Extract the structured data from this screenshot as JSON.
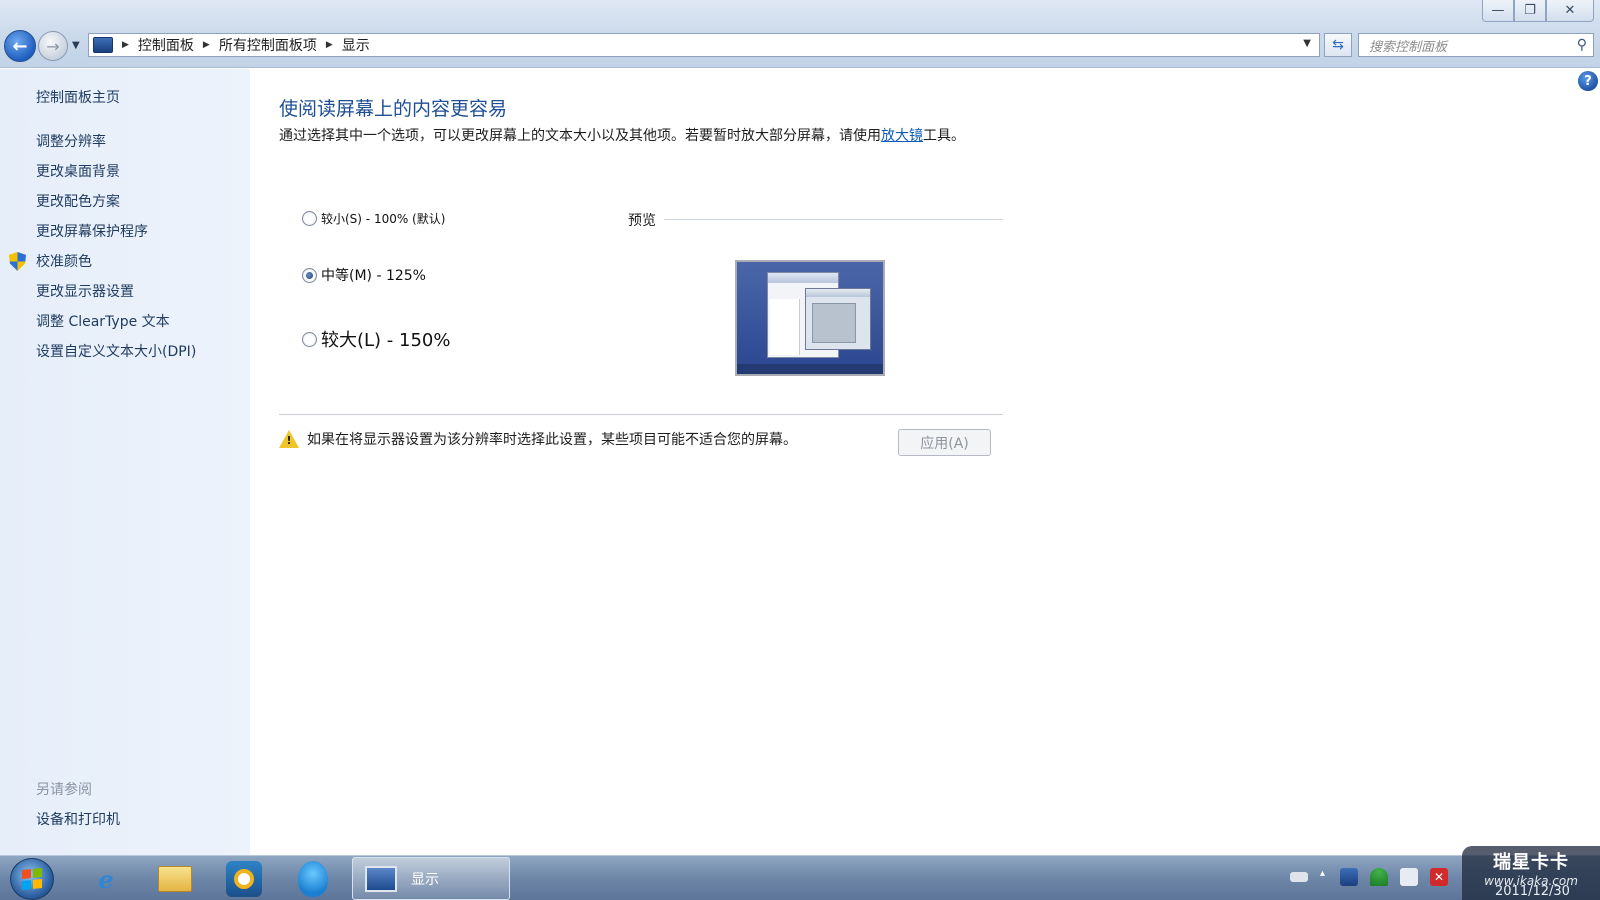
{
  "window": {
    "minimize_glyph": "—",
    "maximize_glyph": "❐",
    "close_glyph": "✕"
  },
  "address_bar": {
    "back_glyph": "←",
    "forward_glyph": "→",
    "breadcrumbs": [
      "控制面板",
      "所有控制面板项",
      "显示"
    ],
    "search_placeholder": "搜索控制面板"
  },
  "sidebar": {
    "home_link": "控制面板主页",
    "tasks": [
      "调整分辨率",
      "更改桌面背景",
      "更改配色方案",
      "更改屏幕保护程序",
      "校准颜色",
      "更改显示器设置",
      "调整 ClearType 文本",
      "设置自定义文本大小(DPI)"
    ],
    "see_also_label": "另请参阅",
    "see_also_links": [
      "设备和打印机"
    ]
  },
  "main": {
    "title": "使阅读屏幕上的内容更容易",
    "description_before": "通过选择其中一个选项，可以更改屏幕上的文本大小以及其他项。若要暂时放大部分屏幕，请使用",
    "description_link": "放大镜",
    "description_after": "工具。",
    "options": [
      {
        "label": "较小(S) - 100% (默认)",
        "checked": false
      },
      {
        "label": "中等(M) - 125%",
        "checked": true
      },
      {
        "label": "较大(L) - 150%",
        "checked": false
      }
    ],
    "preview_label": "预览",
    "warning_text": "如果在将显示器设置为该分辨率时选择此设置，某些项目可能不适合您的屏幕。",
    "apply_button": "应用(A)"
  },
  "taskbar": {
    "active_task_label": "显示",
    "ie_glyph": "e"
  },
  "watermark": {
    "brand": "瑞星卡卡",
    "url": "www.ikaka.com",
    "date": "2011/12/30"
  },
  "colors": {
    "link": "#0f5fb8",
    "title": "#1e4f94",
    "sidebar_bg": "#e6eefa",
    "taskbar": "#6e87a8"
  }
}
